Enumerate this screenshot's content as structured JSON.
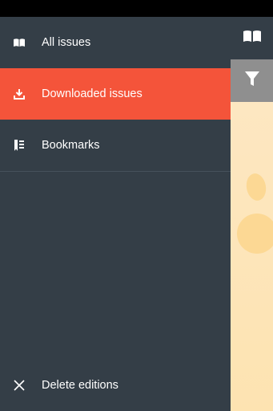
{
  "menu": {
    "items": [
      {
        "label": "All issues",
        "icon": "open-book-icon"
      },
      {
        "label": "Downloaded issues",
        "icon": "download-icon",
        "active": true
      },
      {
        "label": "Bookmarks",
        "icon": "bookmark-list-icon"
      }
    ],
    "delete": {
      "label": "Delete editions",
      "icon": "close-icon"
    }
  },
  "colors": {
    "drawer_bg": "#343e47",
    "active_bg": "#f4543a",
    "filter_bar_bg": "#8f8f8f",
    "content_bg": "#fde8c6"
  }
}
